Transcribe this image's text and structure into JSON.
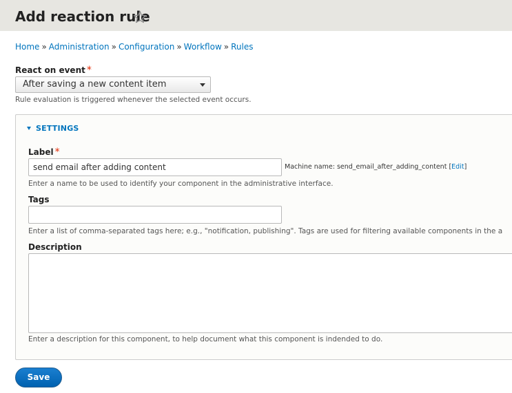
{
  "header": {
    "title": "Add reaction rule",
    "star_icon": "star-outline-icon"
  },
  "breadcrumb": {
    "items": [
      "Home",
      "Administration",
      "Configuration",
      "Workflow",
      "Rules"
    ],
    "separator": "»"
  },
  "event": {
    "label": "React on event",
    "required_marker": "*",
    "selected": "After saving a new content item",
    "help": "Rule evaluation is triggered whenever the selected event occurs."
  },
  "settings": {
    "legend": "SETTINGS",
    "label_field": {
      "label": "Label",
      "required_marker": "*",
      "value": "send email after adding content",
      "machine_name_prefix": "Machine name: send_email_after_adding_content",
      "edit_open": "[",
      "edit_link": "Edit",
      "edit_close": "]",
      "help": "Enter a name to be used to identify your component in the administrative interface."
    },
    "tags_field": {
      "label": "Tags",
      "value": "",
      "help": "Enter a list of comma-separated tags here; e.g., \"notification, publishing\". Tags are used for filtering available components in the a"
    },
    "description_field": {
      "label": "Description",
      "value": "",
      "help": "Enter a description for this component, to help document what this component is indended to do."
    }
  },
  "actions": {
    "save_label": "Save"
  },
  "colors": {
    "link": "#0074bd",
    "required": "#e32700",
    "header_bg": "#e7e6e1",
    "primary_button": "#0071c5"
  }
}
